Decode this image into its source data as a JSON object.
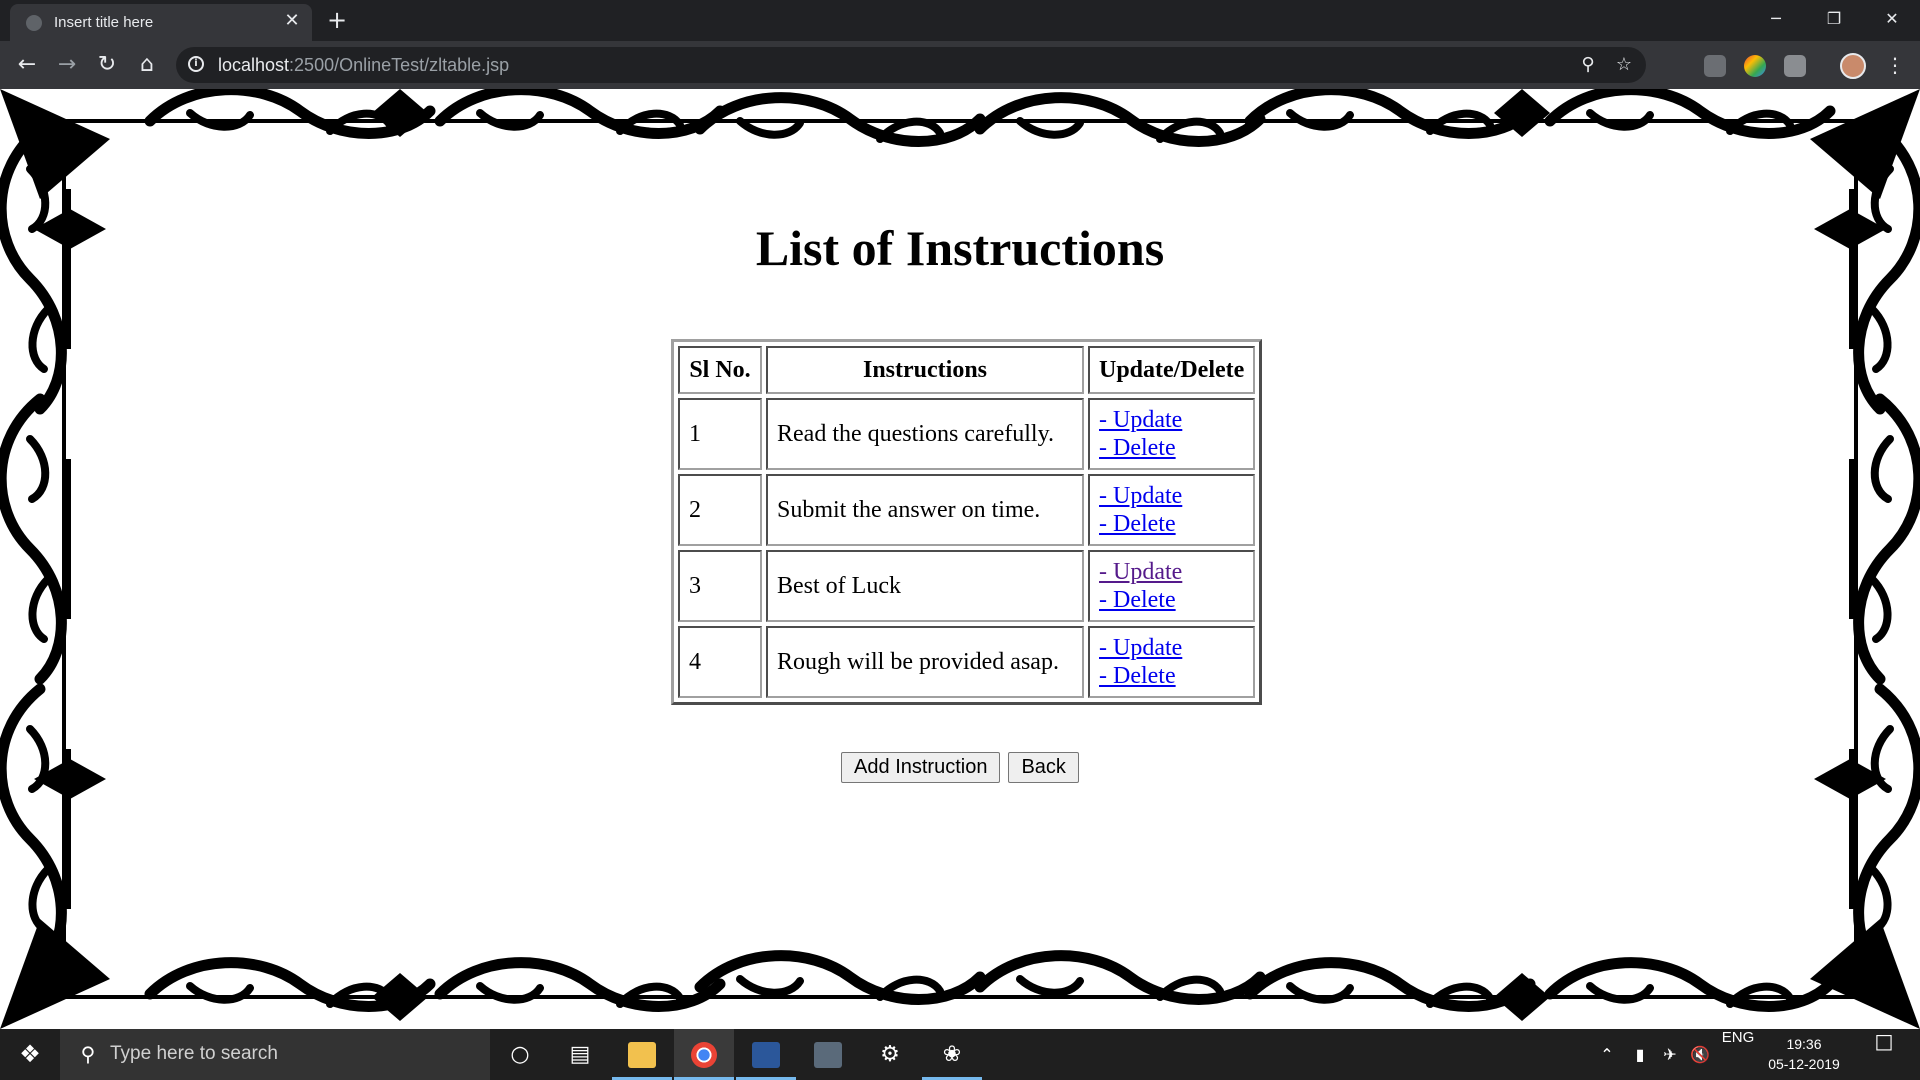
{
  "browser": {
    "tab_title": "Insert title here",
    "tab_close": "✕",
    "new_tab": "+",
    "url_host": "localhost",
    "url_rest": ":2500/OnlineTest/zltable.jsp",
    "window_controls": {
      "minimize": "─",
      "restore": "❐",
      "close": "✕"
    }
  },
  "page": {
    "heading": "List of Instructions",
    "table": {
      "headers": [
        "Sl No.",
        "Instructions",
        "Update/Delete"
      ],
      "rows": [
        {
          "sl": "1",
          "instruction": "Read the questions carefully.",
          "update": "- Update",
          "delete": "- Delete"
        },
        {
          "sl": "2",
          "instruction": "Submit the answer on time.",
          "update": "- Update",
          "delete": "- Delete"
        },
        {
          "sl": "3",
          "instruction": "Best of Luck",
          "update": "- Update",
          "delete": "- Delete"
        },
        {
          "sl": "4",
          "instruction": "Rough will be provided asap.",
          "update": "- Update",
          "delete": "- Delete"
        }
      ]
    },
    "buttons": {
      "add": "Add Instruction",
      "back": "Back"
    }
  },
  "taskbar": {
    "search_placeholder": "Type here to search",
    "language": "ENG",
    "time": "19:36",
    "date": "05-12-2019"
  },
  "colors": {
    "link": "#0000ee",
    "visited_link": "#551a8b",
    "chrome_dark": "#202124",
    "chrome_toolbar": "#35363a",
    "taskbar": "#1f1f1f"
  }
}
